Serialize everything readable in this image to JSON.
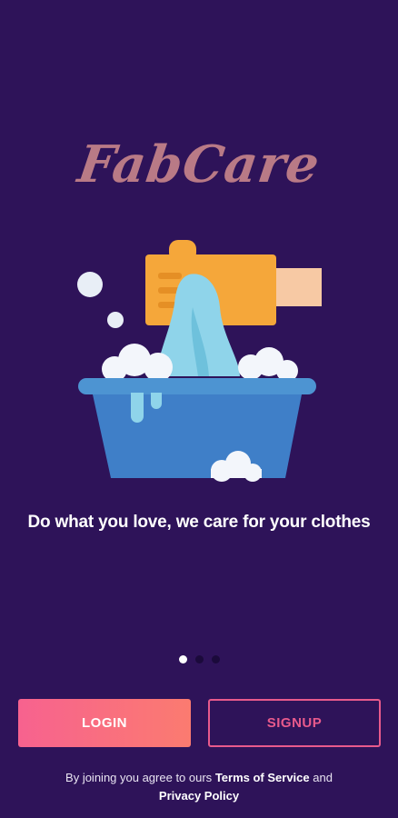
{
  "app": {
    "logo_text": "FabCare",
    "tagline": "Do what you love, we care for your clothes"
  },
  "onboarding": {
    "page_count": 3,
    "current_page": 1
  },
  "actions": {
    "login_label": "LOGIN",
    "signup_label": "SIGNUP"
  },
  "legal": {
    "prefix": "By joining you agree to ours",
    "terms_label": "Terms of Service",
    "conjunction": "and",
    "privacy_label": "Privacy Policy"
  },
  "colors": {
    "background": "#2e1359",
    "logo": "#b97a86",
    "accent_pink": "#f7628f",
    "accent_coral": "#fb7b70",
    "signup_border": "#e85a8c"
  },
  "illustration": {
    "icon": "washing-basin-illustration"
  }
}
